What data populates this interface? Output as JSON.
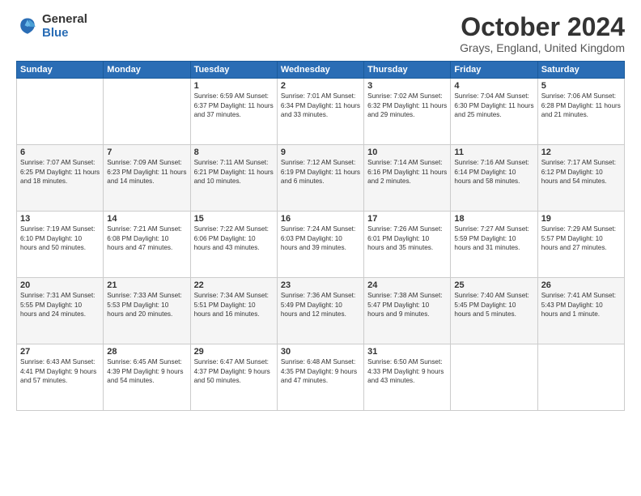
{
  "logo": {
    "general": "General",
    "blue": "Blue"
  },
  "title": "October 2024",
  "subtitle": "Grays, England, United Kingdom",
  "days_header": [
    "Sunday",
    "Monday",
    "Tuesday",
    "Wednesday",
    "Thursday",
    "Friday",
    "Saturday"
  ],
  "weeks": [
    [
      {
        "day": "",
        "info": ""
      },
      {
        "day": "",
        "info": ""
      },
      {
        "day": "1",
        "info": "Sunrise: 6:59 AM\nSunset: 6:37 PM\nDaylight: 11 hours and 37 minutes."
      },
      {
        "day": "2",
        "info": "Sunrise: 7:01 AM\nSunset: 6:34 PM\nDaylight: 11 hours and 33 minutes."
      },
      {
        "day": "3",
        "info": "Sunrise: 7:02 AM\nSunset: 6:32 PM\nDaylight: 11 hours and 29 minutes."
      },
      {
        "day": "4",
        "info": "Sunrise: 7:04 AM\nSunset: 6:30 PM\nDaylight: 11 hours and 25 minutes."
      },
      {
        "day": "5",
        "info": "Sunrise: 7:06 AM\nSunset: 6:28 PM\nDaylight: 11 hours and 21 minutes."
      }
    ],
    [
      {
        "day": "6",
        "info": "Sunrise: 7:07 AM\nSunset: 6:25 PM\nDaylight: 11 hours and 18 minutes."
      },
      {
        "day": "7",
        "info": "Sunrise: 7:09 AM\nSunset: 6:23 PM\nDaylight: 11 hours and 14 minutes."
      },
      {
        "day": "8",
        "info": "Sunrise: 7:11 AM\nSunset: 6:21 PM\nDaylight: 11 hours and 10 minutes."
      },
      {
        "day": "9",
        "info": "Sunrise: 7:12 AM\nSunset: 6:19 PM\nDaylight: 11 hours and 6 minutes."
      },
      {
        "day": "10",
        "info": "Sunrise: 7:14 AM\nSunset: 6:16 PM\nDaylight: 11 hours and 2 minutes."
      },
      {
        "day": "11",
        "info": "Sunrise: 7:16 AM\nSunset: 6:14 PM\nDaylight: 10 hours and 58 minutes."
      },
      {
        "day": "12",
        "info": "Sunrise: 7:17 AM\nSunset: 6:12 PM\nDaylight: 10 hours and 54 minutes."
      }
    ],
    [
      {
        "day": "13",
        "info": "Sunrise: 7:19 AM\nSunset: 6:10 PM\nDaylight: 10 hours and 50 minutes."
      },
      {
        "day": "14",
        "info": "Sunrise: 7:21 AM\nSunset: 6:08 PM\nDaylight: 10 hours and 47 minutes."
      },
      {
        "day": "15",
        "info": "Sunrise: 7:22 AM\nSunset: 6:06 PM\nDaylight: 10 hours and 43 minutes."
      },
      {
        "day": "16",
        "info": "Sunrise: 7:24 AM\nSunset: 6:03 PM\nDaylight: 10 hours and 39 minutes."
      },
      {
        "day": "17",
        "info": "Sunrise: 7:26 AM\nSunset: 6:01 PM\nDaylight: 10 hours and 35 minutes."
      },
      {
        "day": "18",
        "info": "Sunrise: 7:27 AM\nSunset: 5:59 PM\nDaylight: 10 hours and 31 minutes."
      },
      {
        "day": "19",
        "info": "Sunrise: 7:29 AM\nSunset: 5:57 PM\nDaylight: 10 hours and 27 minutes."
      }
    ],
    [
      {
        "day": "20",
        "info": "Sunrise: 7:31 AM\nSunset: 5:55 PM\nDaylight: 10 hours and 24 minutes."
      },
      {
        "day": "21",
        "info": "Sunrise: 7:33 AM\nSunset: 5:53 PM\nDaylight: 10 hours and 20 minutes."
      },
      {
        "day": "22",
        "info": "Sunrise: 7:34 AM\nSunset: 5:51 PM\nDaylight: 10 hours and 16 minutes."
      },
      {
        "day": "23",
        "info": "Sunrise: 7:36 AM\nSunset: 5:49 PM\nDaylight: 10 hours and 12 minutes."
      },
      {
        "day": "24",
        "info": "Sunrise: 7:38 AM\nSunset: 5:47 PM\nDaylight: 10 hours and 9 minutes."
      },
      {
        "day": "25",
        "info": "Sunrise: 7:40 AM\nSunset: 5:45 PM\nDaylight: 10 hours and 5 minutes."
      },
      {
        "day": "26",
        "info": "Sunrise: 7:41 AM\nSunset: 5:43 PM\nDaylight: 10 hours and 1 minute."
      }
    ],
    [
      {
        "day": "27",
        "info": "Sunrise: 6:43 AM\nSunset: 4:41 PM\nDaylight: 9 hours and 57 minutes."
      },
      {
        "day": "28",
        "info": "Sunrise: 6:45 AM\nSunset: 4:39 PM\nDaylight: 9 hours and 54 minutes."
      },
      {
        "day": "29",
        "info": "Sunrise: 6:47 AM\nSunset: 4:37 PM\nDaylight: 9 hours and 50 minutes."
      },
      {
        "day": "30",
        "info": "Sunrise: 6:48 AM\nSunset: 4:35 PM\nDaylight: 9 hours and 47 minutes."
      },
      {
        "day": "31",
        "info": "Sunrise: 6:50 AM\nSunset: 4:33 PM\nDaylight: 9 hours and 43 minutes."
      },
      {
        "day": "",
        "info": ""
      },
      {
        "day": "",
        "info": ""
      }
    ]
  ]
}
